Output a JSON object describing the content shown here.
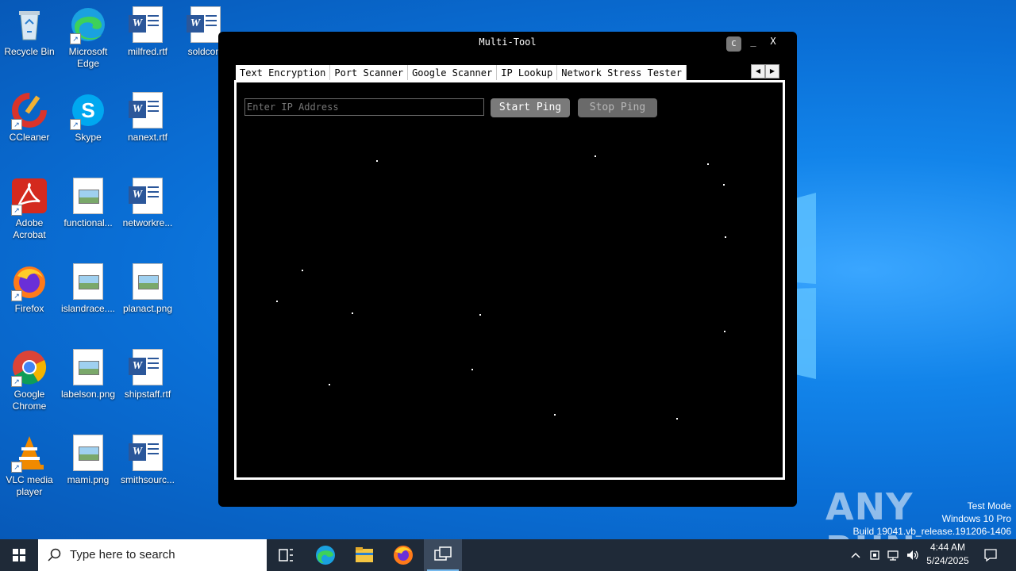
{
  "desktop": {
    "icons": [
      {
        "label": "Recycle Bin",
        "icon": "recycle-bin-icon"
      },
      {
        "label": "Microsoft Edge",
        "icon": "edge-icon"
      },
      {
        "label": "milfred.rtf",
        "icon": "word-document-icon"
      },
      {
        "label": "soldcom",
        "icon": "word-document-icon"
      },
      {
        "label": "CCleaner",
        "icon": "ccleaner-icon"
      },
      {
        "label": "Skype",
        "icon": "skype-icon"
      },
      {
        "label": "nanext.rtf",
        "icon": "word-document-icon"
      },
      {
        "label": "Adobe Acrobat",
        "icon": "acrobat-icon"
      },
      {
        "label": "functional...",
        "icon": "image-file-icon"
      },
      {
        "label": "networkre...",
        "icon": "word-document-icon"
      },
      {
        "label": "Firefox",
        "icon": "firefox-icon"
      },
      {
        "label": "islandrace....",
        "icon": "image-file-icon"
      },
      {
        "label": "planact.png",
        "icon": "image-file-icon"
      },
      {
        "label": "Google Chrome",
        "icon": "chrome-icon"
      },
      {
        "label": "labelson.png",
        "icon": "image-file-icon"
      },
      {
        "label": "shipstaff.rtf",
        "icon": "word-document-icon"
      },
      {
        "label": "VLC media player",
        "icon": "vlc-icon"
      },
      {
        "label": "mami.png",
        "icon": "image-file-icon"
      },
      {
        "label": "smithsourc...",
        "icon": "word-document-icon"
      }
    ]
  },
  "app": {
    "title": "Multi-Tool",
    "theme_button": "C",
    "minimize": "_",
    "close": "X",
    "tabs": [
      "Text Encryption",
      "Port Scanner",
      "Google Scanner",
      "IP Lookup",
      "Network Stress Tester"
    ],
    "active_tab": "Network Stress Tester",
    "ip_input": {
      "value": "",
      "placeholder": "Enter IP Address"
    },
    "start_button": "Start Ping",
    "stop_button": "Stop Ping"
  },
  "watermark": {
    "line1": "Test Mode",
    "line2": "Windows 10 Pro",
    "line3": "Build 19041.vb_release.191206-1406",
    "brand": "ANY RUN"
  },
  "taskbar": {
    "search_placeholder": "Type here to search",
    "time": "4:44 AM",
    "date": "5/24/2025",
    "pinned": [
      "task-view-icon",
      "edge-icon",
      "file-explorer-icon",
      "firefox-icon",
      "multi-tool-app-icon"
    ]
  },
  "colors": {
    "desktop_bg": "#0a6fd6",
    "taskbar_bg": "#1f2a38",
    "input_text": "#22e0e0",
    "window_bg": "#000000"
  }
}
